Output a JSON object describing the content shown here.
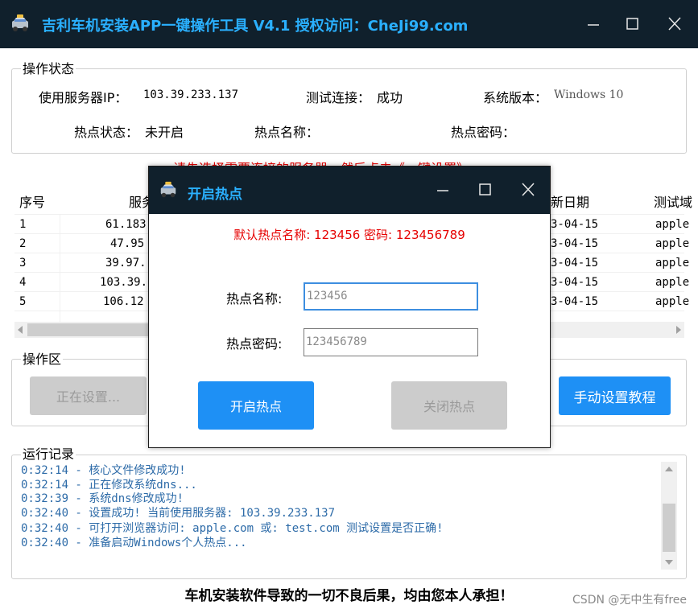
{
  "window": {
    "title": "吉利车机安装APP一键操作工具 V4.1 授权访问：CheJi99.com"
  },
  "status_group": {
    "title": "操作状态",
    "server_ip_label": "使用服务器IP：",
    "server_ip_value": "103.39.233.137",
    "test_conn_label": "测试连接：",
    "test_conn_value": "成功",
    "sys_version_label": "系统版本：",
    "sys_version_value": "Windows 10",
    "hotspot_status_label": "热点状态：",
    "hotspot_status_value": "未开启",
    "hotspot_name_label": "热点名称：",
    "hotspot_name_value": "",
    "hotspot_pwd_label": "热点密码：",
    "hotspot_pwd_value": ""
  },
  "hint": "请先选择需要连接的服务器，然后点击《一键设置》",
  "table": {
    "headers": [
      "序号",
      "服务",
      "新日期",
      "测试域"
    ],
    "rows": [
      {
        "index": "1",
        "server": "61.183",
        "date": "3-04-15",
        "domain": "apple"
      },
      {
        "index": "2",
        "server": "47.95",
        "date": "3-04-15",
        "domain": "apple"
      },
      {
        "index": "3",
        "server": "39.97.",
        "date": "3-04-15",
        "domain": "apple"
      },
      {
        "index": "4",
        "server": "103.39.",
        "date": "3-04-15",
        "domain": "apple"
      },
      {
        "index": "5",
        "server": "106.12",
        "date": "3-04-15",
        "domain": "apple"
      }
    ]
  },
  "ops_group": {
    "title": "操作区",
    "setting_button": "正在设置...",
    "manual_button": "手动设置教程"
  },
  "log_group": {
    "title": "运行记录",
    "lines": [
      "0:32:14 -  核心文件修改成功!",
      "0:32:14 -  正在修改系统dns...",
      "0:32:39 -  系统dns修改成功!",
      "0:32:40 -  设置成功! 当前使用服务器: 103.39.233.137",
      "0:32:40 -  可打开浏览器访问: apple.com 或: test.com 测试设置是否正确!",
      "0:32:40 -  准备启动Windows个人热点..."
    ]
  },
  "footer": "车机安装软件导致的一切不良后果，均由您本人承担！",
  "watermark": "CSDN @无中生有free",
  "dialog": {
    "title": "开启热点",
    "default_info": "默认热点名称: 123456 密码: 123456789",
    "name_label": "热点名称:",
    "name_value": "123456",
    "pwd_label": "热点密码:",
    "pwd_value": "123456789",
    "open_button": "开启热点",
    "close_button": "关闭热点"
  },
  "colors": {
    "title_bg": "#10202c",
    "title_text": "#2ab0ff",
    "accent": "#1e90f5",
    "hint_red": "#e60000",
    "log_text": "#2d6ba8"
  }
}
